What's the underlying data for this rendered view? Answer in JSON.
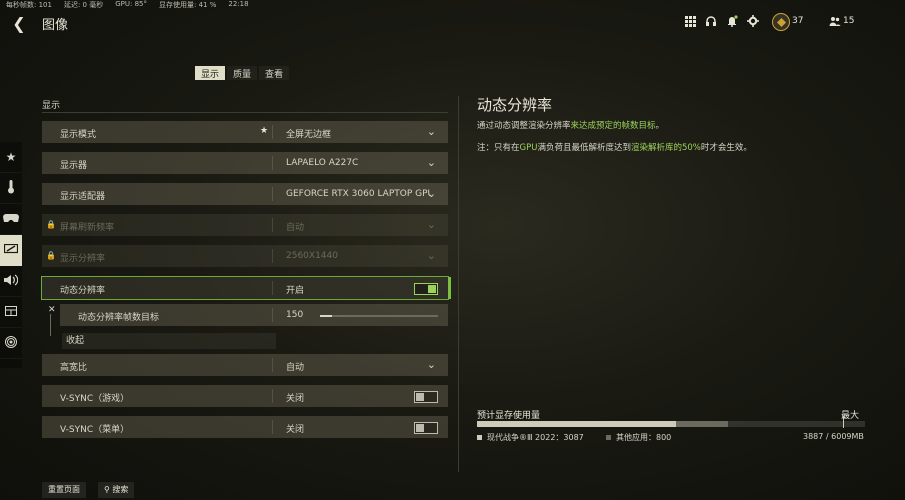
{
  "status_bar": [
    "每秒帧数: 101",
    "延迟: 0 毫秒",
    "GPU: 85°",
    "显存使用量: 41 %",
    "22:18"
  ],
  "header": {
    "title": "图像",
    "back_icon": "chevron-left-icon"
  },
  "top_icons": {
    "badge1_count": "37",
    "badge2_count": "15"
  },
  "tabs": [
    {
      "label": "显示",
      "active": true
    },
    {
      "label": "质量",
      "active": false
    },
    {
      "label": "查看",
      "active": false
    }
  ],
  "section": {
    "title": "显示"
  },
  "rail_icons": [
    "star-icon",
    "thermometer-icon",
    "gamepad-icon",
    "display-icon",
    "speaker-icon",
    "grid-icon",
    "broadcast-icon"
  ],
  "rows": {
    "display_mode": {
      "label": "显示模式",
      "value": "全屏无边框"
    },
    "monitor": {
      "label": "显示器",
      "value": "LAPAELO A227C"
    },
    "adapter": {
      "label": "显示适配器",
      "value": "GEFORCE RTX 3060 LAPTOP GPU"
    },
    "refresh": {
      "label": "屏幕刷新频率",
      "value": "自动"
    },
    "resolution": {
      "label": "显示分辨率",
      "value": "2560X1440"
    },
    "dynamic_res": {
      "label": "动态分辨率",
      "value": "开启"
    },
    "fps_target": {
      "label": "动态分辨率帧数目标",
      "value": "150",
      "fraction": 0.1
    },
    "collapse": {
      "label": "收起"
    },
    "aspect": {
      "label": "高宽比",
      "value": "自动"
    },
    "vsync_game": {
      "label": "V-SYNC（游戏）",
      "value": "关闭"
    },
    "vsync_menu": {
      "label": "V-SYNC（菜单）",
      "value": "关闭"
    }
  },
  "right_panel": {
    "title": "动态分辨率",
    "desc_prefix": "通过动态调整渲染分辨率",
    "desc_green": "来达成预定的帧数目标",
    "desc_suffix": "。",
    "note_a": "注：只有在",
    "note_b": "GPU",
    "note_c": "满负荷且最低解析度达到",
    "note_d": "渲染解析库的",
    "note_e": "50%",
    "note_f": "时才会生效。"
  },
  "vram": {
    "label": "预计显存使用量",
    "max_label": "最大",
    "game_legend": "现代战争®Ⅲ 2022：3087",
    "other_legend": "其他应用：800",
    "total": "3887 / 6009MB",
    "game_mb": 3087,
    "other_mb": 800,
    "total_mb": 6009
  },
  "bottom": {
    "reset": "重置页面",
    "search": "搜索"
  },
  "colors": {
    "accent_green": "#9bd35a",
    "tab_active": "#e0ddc8"
  }
}
